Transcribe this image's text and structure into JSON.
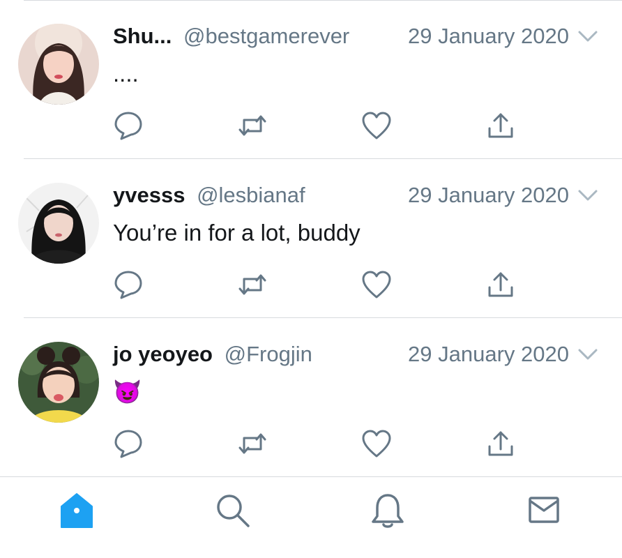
{
  "tweets": [
    {
      "name": "Shu...",
      "handle": "@bestgamerever",
      "date": "29 January 2020",
      "text": "....",
      "avatar_icon": "avatar-photo"
    },
    {
      "name": "yvesss",
      "handle": "@lesbianaf",
      "date": "29 January 2020",
      "text": "You’re in for a lot, buddy",
      "avatar_icon": "avatar-photo"
    },
    {
      "name": "jo yeoyeo",
      "handle": "@Frogjin",
      "date": "29 January 2020",
      "text": "😈",
      "avatar_icon": "avatar-photo"
    }
  ],
  "actions": [
    "reply-icon",
    "retweet-icon",
    "like-icon",
    "share-icon"
  ],
  "tabbar": {
    "items": [
      "home-icon",
      "search-icon",
      "notifications-icon",
      "messages-icon"
    ],
    "active": "home-icon"
  },
  "colors": {
    "accent": "#1da1f2",
    "icon_gray": "#657786",
    "divider": "#d7dadd"
  }
}
